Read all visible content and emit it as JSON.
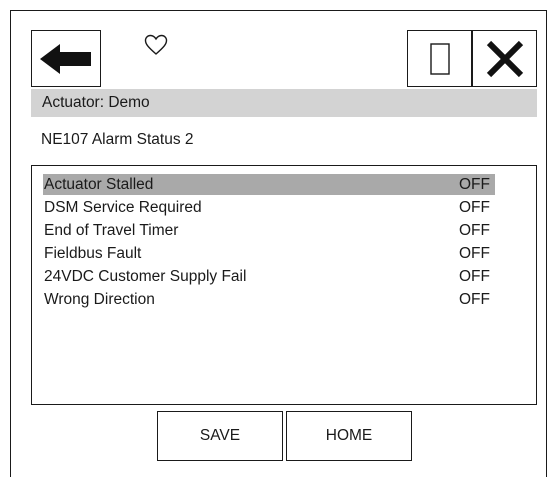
{
  "header": {
    "back_icon": "arrow-left-icon",
    "favorite_icon": "heart-outline-icon",
    "window_icon": "empty-square-icon",
    "close_icon": "close-x-icon"
  },
  "context_label": "Actuator: Demo",
  "screen_title": "NE107 Alarm Status 2",
  "alarms": [
    {
      "label": "Actuator Stalled",
      "value": "OFF",
      "selected": true
    },
    {
      "label": "DSM Service Required",
      "value": "OFF",
      "selected": false
    },
    {
      "label": "End of Travel Timer",
      "value": "OFF",
      "selected": false
    },
    {
      "label": "Fieldbus Fault",
      "value": "OFF",
      "selected": false
    },
    {
      "label": "24VDC Customer Supply Fail",
      "value": "OFF",
      "selected": false
    },
    {
      "label": "Wrong Direction",
      "value": "OFF",
      "selected": false
    }
  ],
  "footer": {
    "save_label": "SAVE",
    "home_label": "HOME"
  },
  "colors": {
    "context_bar_bg": "#d3d3d3",
    "selected_row_bg": "#a9a9a9",
    "line": "#1a1a1a"
  }
}
